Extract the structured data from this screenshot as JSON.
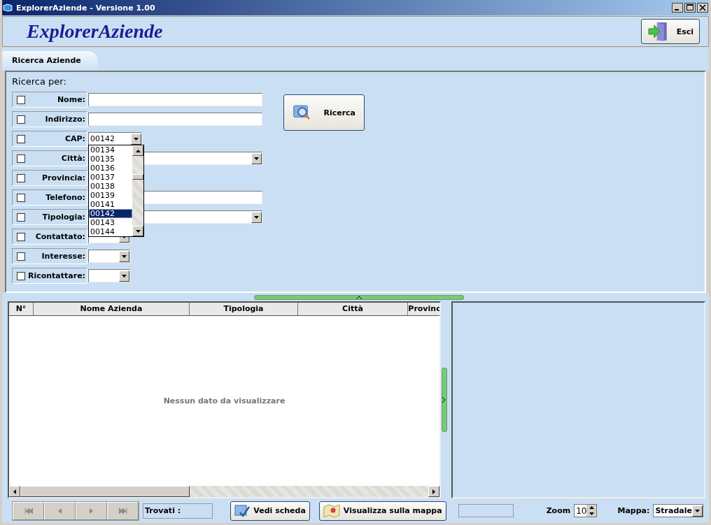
{
  "window": {
    "title": "ExplorerAziende  -  Versione 1.00"
  },
  "header": {
    "logo": "ExplorerAziende",
    "exit_button": "Esci"
  },
  "tabs": [
    {
      "label": "Ricerca Aziende",
      "selected": true
    }
  ],
  "search": {
    "title": "Ricerca per:",
    "button": "Ricerca",
    "criteria": [
      {
        "label": "Nome:",
        "checked": false,
        "kind": "text"
      },
      {
        "label": "Indirizzo:",
        "checked": false,
        "kind": "text"
      },
      {
        "label": "CAP:",
        "checked": false,
        "kind": "combo-short",
        "value": "00142",
        "open": true,
        "options": [
          {
            "label": "00134",
            "selected": false
          },
          {
            "label": "00135",
            "selected": false
          },
          {
            "label": "00136",
            "selected": false
          },
          {
            "label": "00137",
            "selected": false
          },
          {
            "label": "00138",
            "selected": false
          },
          {
            "label": "00139",
            "selected": false
          },
          {
            "label": "00141",
            "selected": false
          },
          {
            "label": "00142",
            "selected": true
          },
          {
            "label": "00143",
            "selected": false
          },
          {
            "label": "00144",
            "selected": false
          }
        ]
      },
      {
        "label": "Città:",
        "checked": false,
        "kind": "combo-long"
      },
      {
        "label": "Provincia:",
        "checked": false,
        "kind": "none"
      },
      {
        "label": "Telefono:",
        "checked": false,
        "kind": "text"
      },
      {
        "label": "Tipologia:",
        "checked": false,
        "kind": "combo-long"
      },
      {
        "label": "Contattato:",
        "checked": false,
        "kind": "combo-small"
      },
      {
        "label": "Interesse:",
        "checked": false,
        "kind": "combo-small"
      },
      {
        "label": "Ricontattare:",
        "checked": false,
        "kind": "combo-small"
      }
    ]
  },
  "table": {
    "columns": [
      "N°",
      "Nome Azienda",
      "Tipologia",
      "Città",
      "Provinc"
    ],
    "empty_message": "Nessun dato da visualizzare"
  },
  "footer": {
    "found_label": "Trovati :",
    "detail_button": "Vedi scheda",
    "map_button": "Visualizza sulla mappa",
    "zoom_label": "Zoom",
    "zoom_value": "10",
    "map_label": "Mappa:",
    "map_value": "Stradale"
  }
}
